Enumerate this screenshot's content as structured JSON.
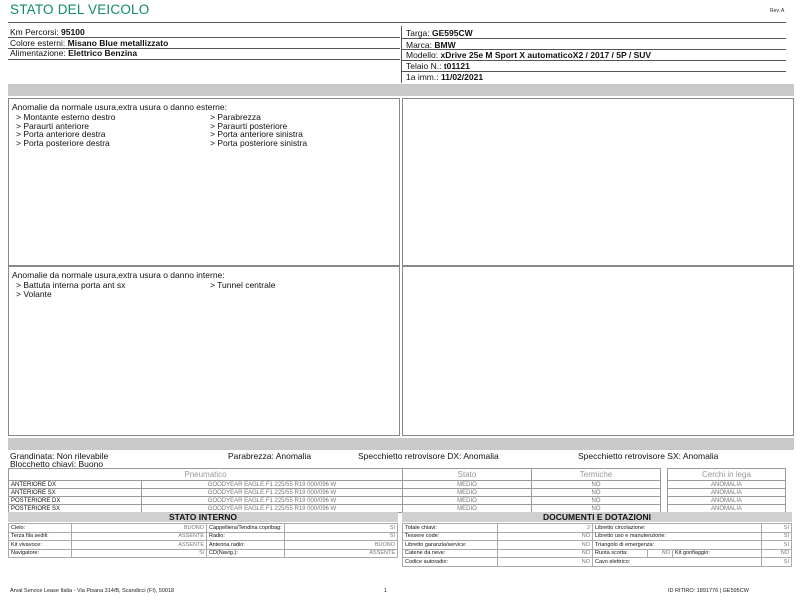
{
  "header": {
    "title": "STATO DEL VEICOLO",
    "rev": "Rev. A"
  },
  "vehicle_left": [
    {
      "label": "Km Percorsi:",
      "value": "95100"
    },
    {
      "label": "Colore esterni:",
      "value": "Misano Blue metallizzato"
    },
    {
      "label": "Alimentazione:",
      "value": "Elettrico Benzina"
    }
  ],
  "vehicle_right": [
    {
      "label": "Targa:",
      "value": "GE595CW"
    },
    {
      "label": "Marca:",
      "value": "BMW"
    },
    {
      "label": "Modello:",
      "value": "xDrive 25e M Sport X automaticoX2 / 2017 / 5P / SUV"
    },
    {
      "label": "Telaio N.:",
      "value": "t01121"
    },
    {
      "label": "1a imm.:",
      "value": "11/02/2021"
    }
  ],
  "external": {
    "title": "Anomalie da normale usura,extra usura o danno esterne:",
    "col1": [
      "> Montante esterno destro",
      "> Paraurti anteriore",
      "> Porta anteriore destra",
      "> Porta posteriore destra"
    ],
    "col2": [
      "> Parabrezza",
      "> Paraurti posteriore",
      "> Porta anteriore sinistra",
      "> Porta posteriore sinistra"
    ]
  },
  "internal": {
    "title": "Anomalie da normale usura,extra usura o danno interne:",
    "col1": [
      "> Battuta interna porta ant sx",
      "> Volante"
    ],
    "col2": [
      "> Tunnel centrale"
    ]
  },
  "status_line": {
    "grandinata": "Grandinata: Non rilevabile",
    "parabrezza": "Parabrezza: Anomalia",
    "specchietto_dx": "Specchietto retrovisore DX: Anomalia",
    "specchietto_sx": "Specchietto retrovisore SX: Anomalia",
    "bloccchetto": "Blocchetto chiavi: Buono"
  },
  "tyres": {
    "headers": [
      "Pneumatico",
      "Stato",
      "Termiche",
      "Cerchi in lega"
    ],
    "rows": [
      {
        "pos": "ANTERIORE DX",
        "tyre": "GOODYEAR EAGLE F1  225/55 R19 000/096 W",
        "stato": "MEDIO",
        "termiche": "NO",
        "cerchi": "ANOMALIA"
      },
      {
        "pos": "ANTERIORE SX",
        "tyre": "GOODYEAR EAGLE F1  225/55 R19 000/096 W",
        "stato": "MEDIO",
        "termiche": "NO",
        "cerchi": "ANOMALIA"
      },
      {
        "pos": "POSTERIORE DX",
        "tyre": "GOODYEAR EAGLE F1  225/55 R19 000/096 W",
        "stato": "MEDIO",
        "termiche": "NO",
        "cerchi": "ANOMALIA"
      },
      {
        "pos": "POSTERIORE SX",
        "tyre": "GOODYEAR EAGLE F1  225/55 R19 000/096 W",
        "stato": "MEDIO",
        "termiche": "NO",
        "cerchi": "ANOMALIA"
      }
    ]
  },
  "stato_interno": {
    "title": "STATO INTERNO",
    "rows": [
      [
        "Cielo:",
        "BUONO",
        "Cappelliera/Tendina copribag:",
        "SI"
      ],
      [
        "Terza fila sedili:",
        "ASSENTE",
        "Radio:",
        "SI"
      ],
      [
        "Kit vivavoce:",
        "ASSENTE",
        "Antenna radio:",
        "BUONO"
      ],
      [
        "Navigatore:",
        "Si",
        "CD(Navig.):",
        "ASSENTE"
      ]
    ]
  },
  "documenti": {
    "title": "DOCUMENTI E DOTAZIONI",
    "rows": [
      [
        "Totale chiavi:",
        "2",
        "Libretto circolazione:",
        "SI"
      ],
      [
        "Tessere code:",
        "NO",
        "Libretto uso e manutenzione:",
        "SI"
      ],
      [
        "Libretto garanzia/service:",
        "NO",
        "Triangolo di emergenza:",
        "SI"
      ],
      [
        "Catene da neve:",
        "NO",
        "Ruota scorta:",
        "NO",
        "Kit gonfiaggio:",
        "NO"
      ],
      [
        "Codice autoradio:",
        "NO",
        "Cavo elettrico:",
        "SI"
      ]
    ]
  },
  "footer": {
    "left": "Arval Service Lease Italia - Via Pisana 314/B, Scandicci (FI), 50018",
    "page": "1",
    "right": "ID RITIRO: 1891776 | GE595CW"
  }
}
